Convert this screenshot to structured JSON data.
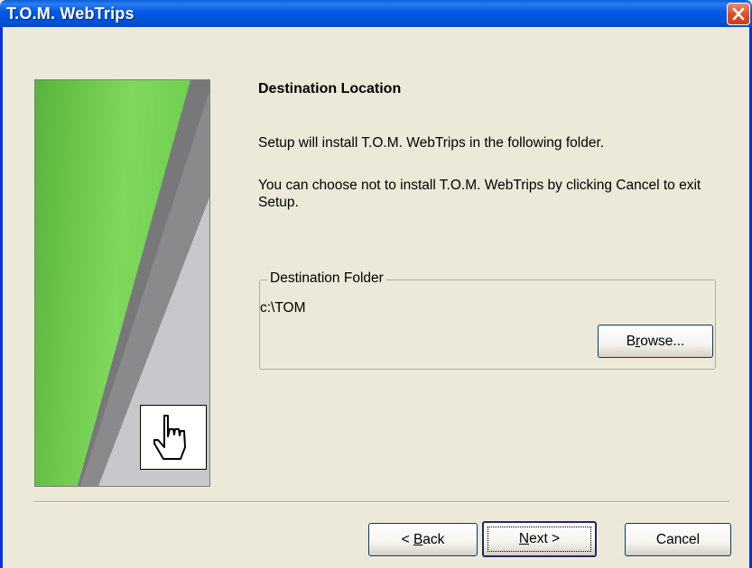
{
  "window": {
    "title": "T.O.M. WebTrips",
    "close_icon": "close-icon"
  },
  "page": {
    "heading": "Destination Location",
    "line1": "Setup will install T.O.M. WebTrips in the following folder.",
    "line2": "You can choose not to install T.O.M. WebTrips by clicking Cancel to exit Setup.",
    "side_icon": "hand-pointer-icon"
  },
  "destination": {
    "group_label": "Destination Folder",
    "path": "c:\\TOM",
    "browse_label_pre": "B",
    "browse_label_mnemonic": "r",
    "browse_label_post": "owse..."
  },
  "buttons": {
    "back_pre": "< ",
    "back_mnemonic": "B",
    "back_post": "ack",
    "next_mnemonic": "N",
    "next_post": "ext >",
    "cancel": "Cancel"
  },
  "colors": {
    "titlebar": "#0058e6",
    "dialog_bg": "#ece9d8",
    "accent_green": "#6fcf4f"
  }
}
